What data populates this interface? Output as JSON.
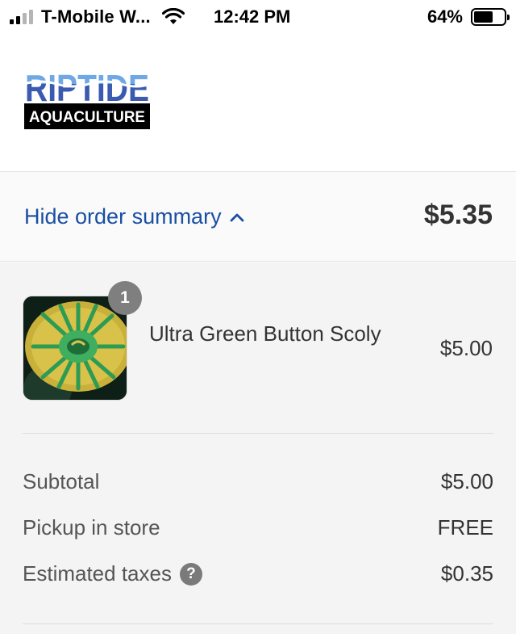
{
  "status_bar": {
    "carrier": "T-Mobile W...",
    "time": "12:42 PM",
    "battery_percent": "64%",
    "battery_level": 0.64,
    "signal_bars": 2,
    "icons": [
      "signal-icon",
      "wifi-icon",
      "battery-icon"
    ]
  },
  "logo": {
    "brand_top": "RIPTIDE",
    "brand_bottom": "AQUACULTURE"
  },
  "summary": {
    "toggle_label": "Hide order summary",
    "toggle_icon": "chevron-up-icon",
    "total": "$5.35"
  },
  "line_items": [
    {
      "quantity": "1",
      "name": "Ultra Green Button Scoly",
      "price": "$5.00"
    }
  ],
  "totals": {
    "subtotal_label": "Subtotal",
    "subtotal_value": "$5.00",
    "shipping_label": "Pickup in store",
    "shipping_value": "FREE",
    "taxes_label": "Estimated taxes",
    "taxes_help": "?",
    "taxes_value": "$0.35"
  },
  "colors": {
    "link": "#1a4fa3",
    "logo_blue": "#6fa8e4",
    "logo_dark": "#3b5bb0",
    "panel_bg": "#f4f4f4"
  }
}
